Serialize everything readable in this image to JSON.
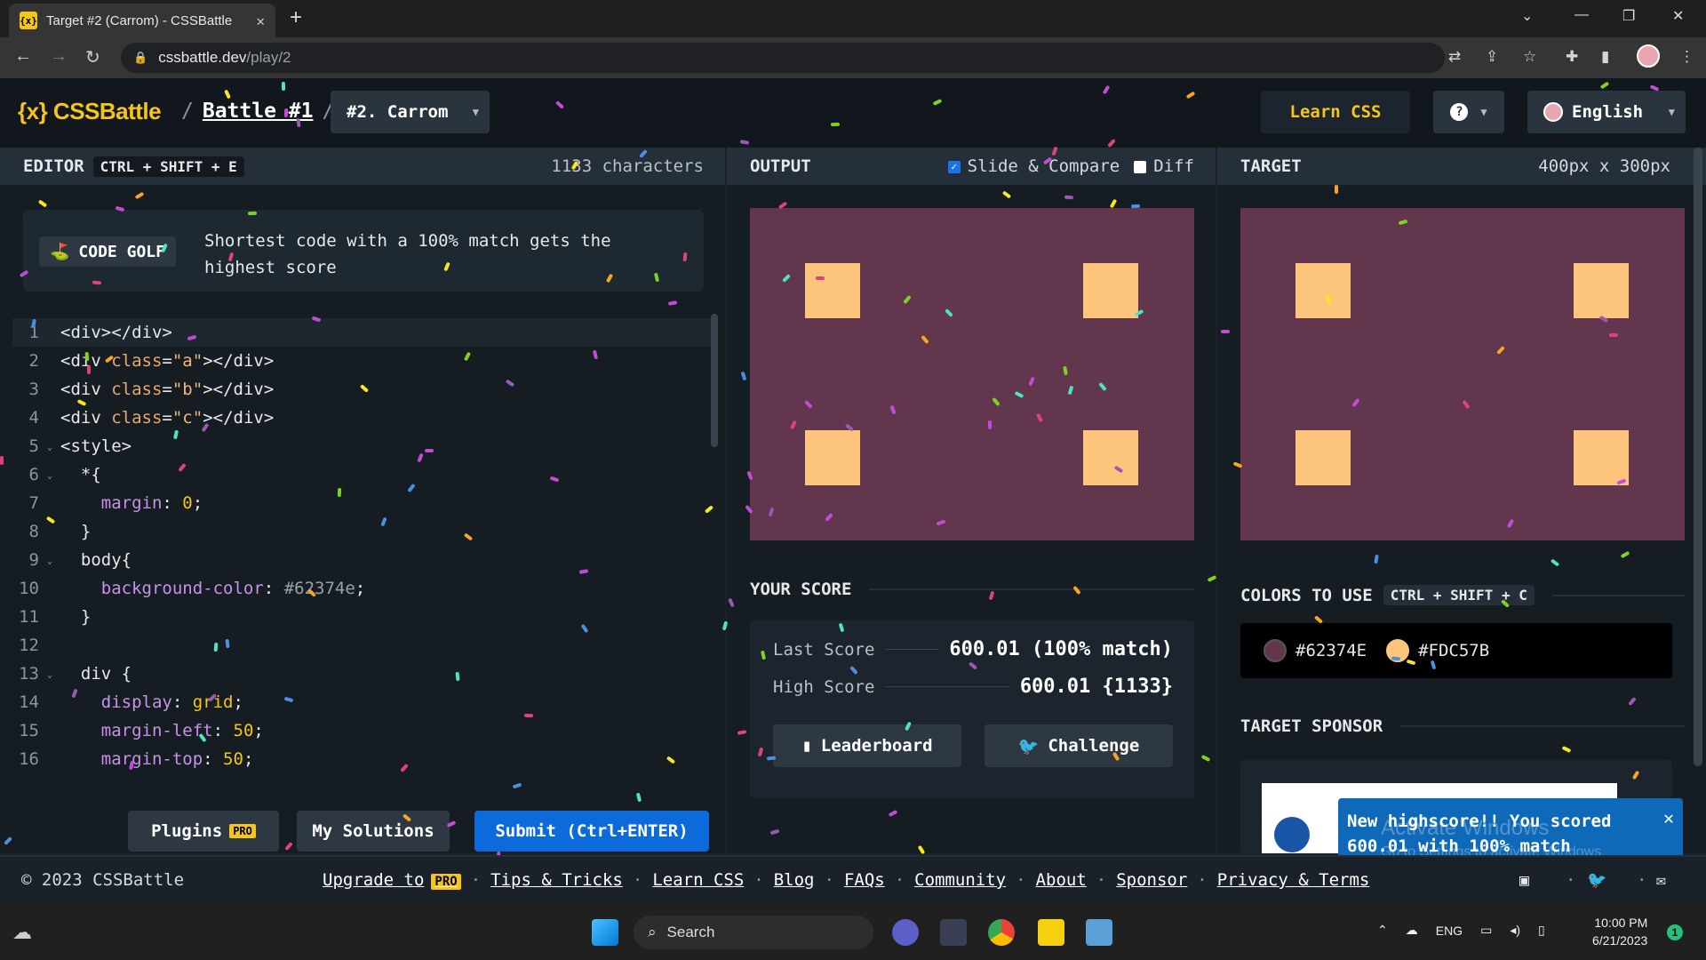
{
  "browser": {
    "tab_title": "Target #2 (Carrom) - CSSBattle",
    "favicon_text": "{x}",
    "url_domain": "cssbattle.dev",
    "url_path": "/play/2"
  },
  "header": {
    "logo": "{x} CSSBattle",
    "battle_link": "Battle #1",
    "target_select": "#2. Carrom",
    "learn_css": "Learn CSS",
    "help_icon": "?",
    "language": "English"
  },
  "editor": {
    "label": "EDITOR",
    "shortcut": "CTRL + SHIFT + E",
    "char_count": "1133 characters",
    "golf_badge": "CODE GOLF",
    "golf_desc": "Shortest code with a 100% match gets the highest score",
    "lines": [
      {
        "n": "1",
        "fold": "",
        "code": "<div></div>"
      },
      {
        "n": "2",
        "fold": "",
        "code": "<div class=\"a\"></div>"
      },
      {
        "n": "3",
        "fold": "",
        "code": "<div class=\"b\"></div>"
      },
      {
        "n": "4",
        "fold": "",
        "code": "<div class=\"c\"></div>"
      },
      {
        "n": "5",
        "fold": "⌄",
        "code": "<style>"
      },
      {
        "n": "6",
        "fold": "⌄",
        "code": "  *{"
      },
      {
        "n": "7",
        "fold": "",
        "code": "    margin: 0;"
      },
      {
        "n": "8",
        "fold": "",
        "code": "  }"
      },
      {
        "n": "9",
        "fold": "⌄",
        "code": "  body{"
      },
      {
        "n": "10",
        "fold": "",
        "code": "    background-color: #62374e;"
      },
      {
        "n": "11",
        "fold": "",
        "code": "  }"
      },
      {
        "n": "12",
        "fold": "",
        "code": ""
      },
      {
        "n": "13",
        "fold": "⌄",
        "code": "  div {"
      },
      {
        "n": "14",
        "fold": "",
        "code": "    display: grid;"
      },
      {
        "n": "15",
        "fold": "",
        "code": "    margin-left: 50;"
      },
      {
        "n": "16",
        "fold": "",
        "code": "    margin-top: 50;"
      }
    ],
    "plugins": "Plugins",
    "pro": "PRO",
    "my_solutions": "My Solutions",
    "submit": "Submit (Ctrl+ENTER)"
  },
  "output": {
    "label": "OUTPUT",
    "slide_compare": "Slide & Compare",
    "slide_compare_checked": true,
    "diff": "Diff",
    "diff_checked": false,
    "your_score": "YOUR SCORE",
    "last_score_label": "Last Score",
    "last_score": "600.01 (100% match)",
    "high_score_label": "High Score",
    "high_score": "600.01 {1133}",
    "leaderboard": "Leaderboard",
    "challenge": "Challenge"
  },
  "target": {
    "label": "TARGET",
    "dimensions": "400px x 300px",
    "colors_to_use": "COLORS TO USE",
    "colors_shortcut": "CTRL + SHIFT + C",
    "colors": [
      "#62374E",
      "#FDC57B"
    ],
    "sponsor": "TARGET SPONSOR"
  },
  "toast": {
    "message": "New highscore!! You scored 600.01 with 100% match",
    "close": "✕"
  },
  "watermark": {
    "title": "Activate Windows",
    "subtitle": "Go to Settings to activate Windows."
  },
  "footer": {
    "copyright": "© 2023 CSSBattle",
    "upgrade": "Upgrade to",
    "pro": "PRO",
    "links": [
      "Tips & Tricks",
      "Learn CSS",
      "Blog",
      "FAQs",
      "Community",
      "About",
      "Sponsor",
      "Privacy & Terms"
    ]
  },
  "taskbar": {
    "search": "Search",
    "lang": "ENG",
    "time": "10:00 PM",
    "date": "6/21/2023",
    "notif_count": "1"
  },
  "theme": {
    "target_bg": "#62374e",
    "target_fg": "#fdc57b",
    "accent": "#f5c518",
    "submit": "#0d6adb"
  }
}
